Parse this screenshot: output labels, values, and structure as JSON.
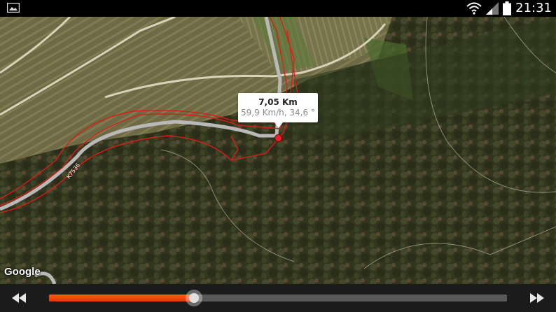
{
  "status_bar": {
    "time": "21:31",
    "icons": [
      "image-icon",
      "wifi-icon",
      "signal-icon",
      "battery-icon"
    ]
  },
  "map": {
    "attribution": "Google",
    "road_label": "K7536",
    "info_window": {
      "distance": "7,05 Km",
      "details": "59,9 Km/h, 34,6 °"
    },
    "marker_color": "#e8212a",
    "track_color": "#d91e18"
  },
  "player": {
    "rewind_icon": "rewind-icon",
    "forward_icon": "fast-forward-icon",
    "progress": 0.316,
    "accent": "#ff4a10"
  }
}
